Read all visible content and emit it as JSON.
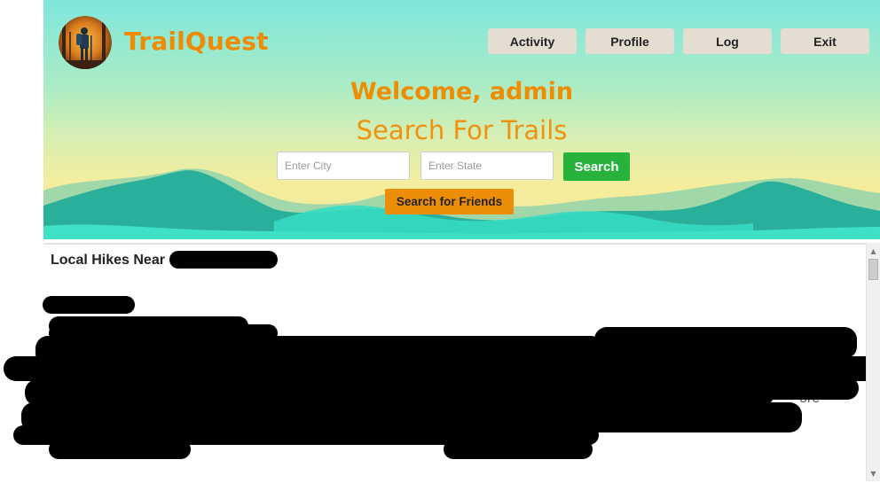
{
  "brand": {
    "name": "TrailQuest"
  },
  "nav": {
    "items": [
      {
        "label": "Activity"
      },
      {
        "label": "Profile"
      },
      {
        "label": "Log"
      },
      {
        "label": "Exit"
      }
    ]
  },
  "hero": {
    "welcome": "Welcome, admin",
    "heading": "Search For Trails"
  },
  "search": {
    "city_placeholder": "Enter City",
    "state_placeholder": "Enter State",
    "button_label": "Search",
    "friends_button_label": "Search for Friends"
  },
  "results": {
    "title": "Local Hikes Near",
    "stray_text": "ore"
  },
  "colors": {
    "brand_orange": "#f08a00",
    "search_green": "#27b23b",
    "friends_orange": "#ec8d07",
    "nav_button_bg": "#e4ddd2",
    "mountain_teal": "#29b19b"
  },
  "icons": {
    "logo": "hiker-logo",
    "scroll_up": "scroll-up-icon",
    "scroll_down": "scroll-down-icon"
  }
}
